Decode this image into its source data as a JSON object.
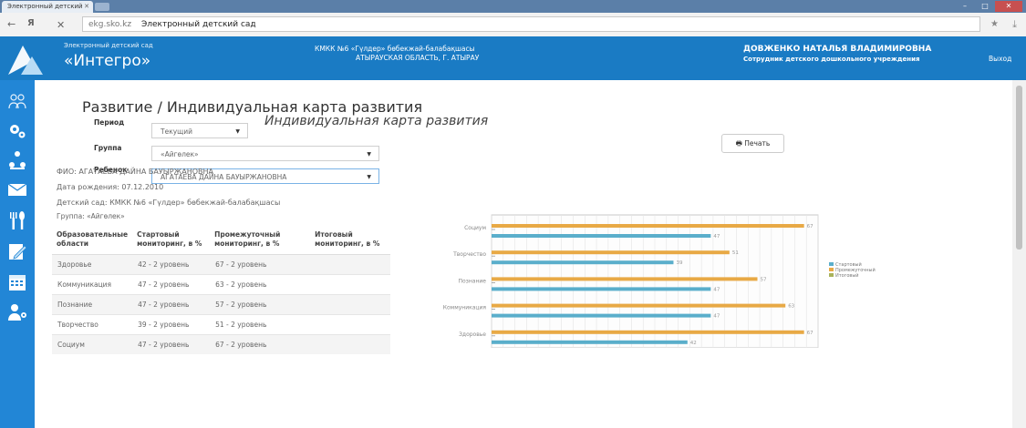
{
  "browser": {
    "tab_title": "Электронный детский",
    "host": "ekg.sko.kz",
    "address_title": "Электронный детский сад"
  },
  "header": {
    "brand_small": "Электронный детский сад",
    "brand_big": "«Интегро»",
    "org_line1": "КМКК №6 «Гүлдер» бөбекжай-балабақшасы",
    "org_line2": "АТЫРАУСКАЯ ОБЛАСТЬ, Г. АТЫРАУ",
    "user_name": "ДОВЖЕНКО НАТАЛЬЯ ВЛАДИМИРОВНА",
    "user_role": "Сотрудник детского дошкольного учреждения",
    "logout": "Выход"
  },
  "sidebar": {
    "icons": [
      "people-icon",
      "settings-icon",
      "hierarchy-icon",
      "mail-icon",
      "cutlery-icon",
      "edit-icon",
      "calendar-icon",
      "user-settings-icon"
    ]
  },
  "page": {
    "title": "Развитие / Индивидуальная карта развития",
    "filters": {
      "period_label": "Период",
      "period_value": "Текущий",
      "group_label": "Группа",
      "group_value": "«Айгөлек»",
      "child_label": "Ребенок",
      "child_value": "АГАТАЕВА ДАЙНА БАУЫРЖАНОВНА"
    },
    "card_title": "Индивидуальная карта развития",
    "print_label": "Печать",
    "info": {
      "fio": "ФИО: АГАТАЕВА ДАЙНА БАУЫРЖАНОВНА",
      "birth": "Дата рождения: 07.12.2010",
      "kindergarten": "Детский сад: КМКК №6 «Гүлдер» бөбекжай-балабақшасы",
      "group": "Группа: «Айгөлек»"
    },
    "table": {
      "headers": [
        "Образовательные области",
        "Стартовый мониторинг, в %",
        "Промежуточный мониторинг, в %",
        "Итоговый мониторинг, в %"
      ],
      "rows": [
        [
          "Здоровье",
          "42 - 2 уровень",
          "67 - 2 уровень",
          ""
        ],
        [
          "Коммуникация",
          "47 - 2 уровень",
          "63 - 2 уровень",
          ""
        ],
        [
          "Познание",
          "47 - 2 уровень",
          "57 - 2 уровень",
          ""
        ],
        [
          "Творчество",
          "39 - 2 уровень",
          "51 - 2 уровень",
          ""
        ],
        [
          "Социум",
          "47 - 2 уровень",
          "67 - 2 уровень",
          ""
        ]
      ]
    }
  },
  "chart_data": {
    "type": "bar",
    "orientation": "horizontal",
    "categories": [
      "Социум",
      "Творчество",
      "Познание",
      "Коммуникация",
      "Здоровье"
    ],
    "series": [
      {
        "name": "Стартовый",
        "values": [
          47,
          39,
          47,
          47,
          42
        ],
        "color": "#5aaecb"
      },
      {
        "name": "Промежуточный",
        "values": [
          67,
          51,
          57,
          63,
          67
        ],
        "color": "#e8a945"
      },
      {
        "name": "Итоговый",
        "values": [
          null,
          null,
          null,
          null,
          null
        ],
        "color": "#a8b25a"
      }
    ],
    "xlim": [
      0,
      70
    ],
    "grid": true,
    "legend_position": "right"
  }
}
